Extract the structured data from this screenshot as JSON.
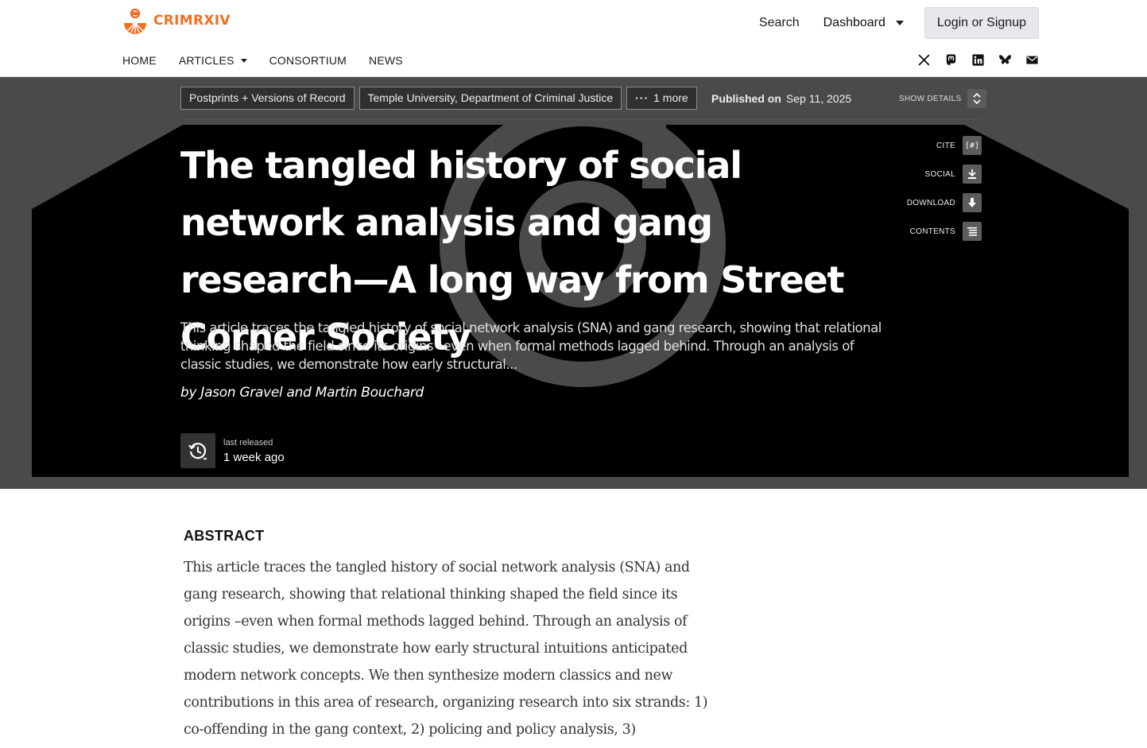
{
  "header": {
    "brand": "CRIMRXIV",
    "search_label": "Search",
    "dashboard_label": "Dashboard",
    "login_label": "Login or Signup",
    "accent_color": "#f26f21"
  },
  "nav": {
    "items": [
      {
        "label": "HOME",
        "name": "nav-home"
      },
      {
        "label": "ARTICLES",
        "name": "nav-articles",
        "dropdown": true
      },
      {
        "label": "CONSORTIUM",
        "name": "nav-consortium"
      },
      {
        "label": "NEWS",
        "name": "nav-news"
      }
    ],
    "social_icons": [
      "x-icon",
      "mastodon-icon",
      "linkedin-icon",
      "bluesky-icon",
      "email-icon"
    ]
  },
  "hero": {
    "pills": [
      "Postprints + Versions of Record",
      "Temple University, Department of Criminal Justice",
      "1 more"
    ],
    "published_label": "Published on",
    "published_date": "Sep 11, 2025",
    "show_details_label": "SHOW DETAILS",
    "actions": [
      {
        "label": "CITE",
        "icon": "cite-icon"
      },
      {
        "label": "SOCIAL",
        "icon": "share-icon"
      },
      {
        "label": "DOWNLOAD",
        "icon": "download-icon"
      },
      {
        "label": "CONTENTS",
        "icon": "contents-icon"
      }
    ],
    "title": "The tangled history of social network analysis and gang research—A long way from Street Corner Society",
    "summary": "This article traces the tangled history of social network analysis (SNA) and gang research, showing that relational thinking shaped the field since its origins –even when formal methods lagged behind. Through an analysis of classic studies, we demonstrate how early structural...",
    "byline": "by Jason Gravel and Martin Bouchard",
    "release_label": "last released",
    "release_value": "1 week ago"
  },
  "abstract": {
    "heading": "ABSTRACT",
    "text": "This article traces the tangled history of social network analysis (SNA) and gang research, showing that relational thinking shaped the field since its origins –even when formal methods lagged behind. Through an analysis of classic studies, we demonstrate how early structural intuitions anticipated modern network concepts. We then synthesize modern classics and new contributions in this area of research, organizing research into six strands: 1) co-offending in the gang context, 2) policing and policy analysis, 3)"
  }
}
